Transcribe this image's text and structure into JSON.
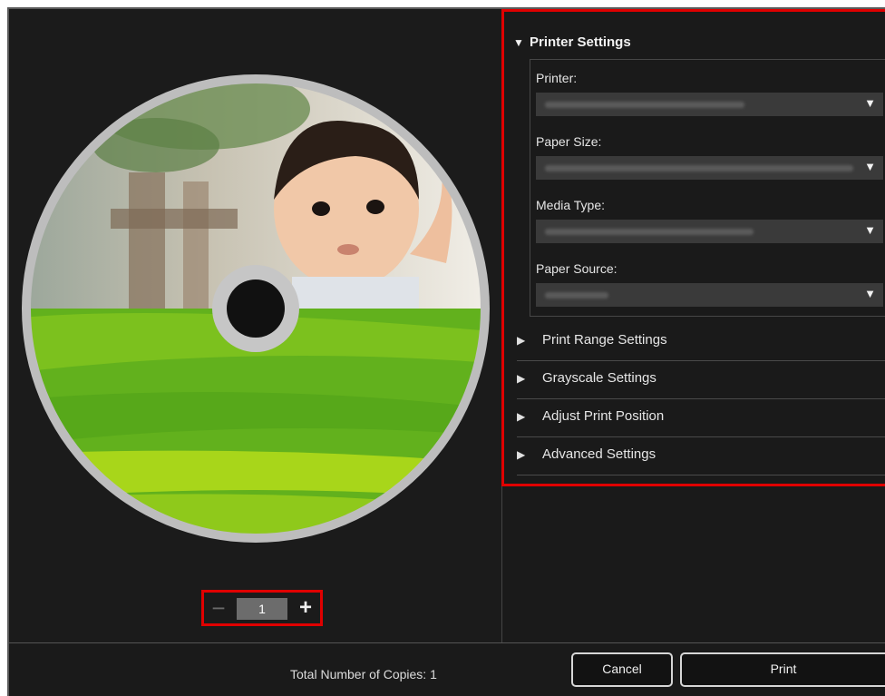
{
  "preview": {
    "copies_value": "1",
    "minus_symbol": "−",
    "plus_symbol": "+"
  },
  "printer_settings": {
    "title": "Printer Settings",
    "fields": [
      {
        "label": "Printer:"
      },
      {
        "label": "Paper Size:"
      },
      {
        "label": "Media Type:"
      },
      {
        "label": "Paper Source:"
      }
    ]
  },
  "sections": [
    {
      "label": "Print Range Settings"
    },
    {
      "label": "Grayscale Settings"
    },
    {
      "label": "Adjust Print Position"
    },
    {
      "label": "Advanced Settings"
    }
  ],
  "footer": {
    "total_copies": "Total Number of Copies: 1",
    "cancel_label": "Cancel",
    "print_label": "Print"
  },
  "icons": {
    "expanded": "triangle-down-icon",
    "collapsed": "triangle-right-icon",
    "dropdown": "chevron-down-icon"
  },
  "colors": {
    "highlight": "#e00000",
    "background": "#1a1a1a",
    "disc_green": "#7cc11e"
  }
}
